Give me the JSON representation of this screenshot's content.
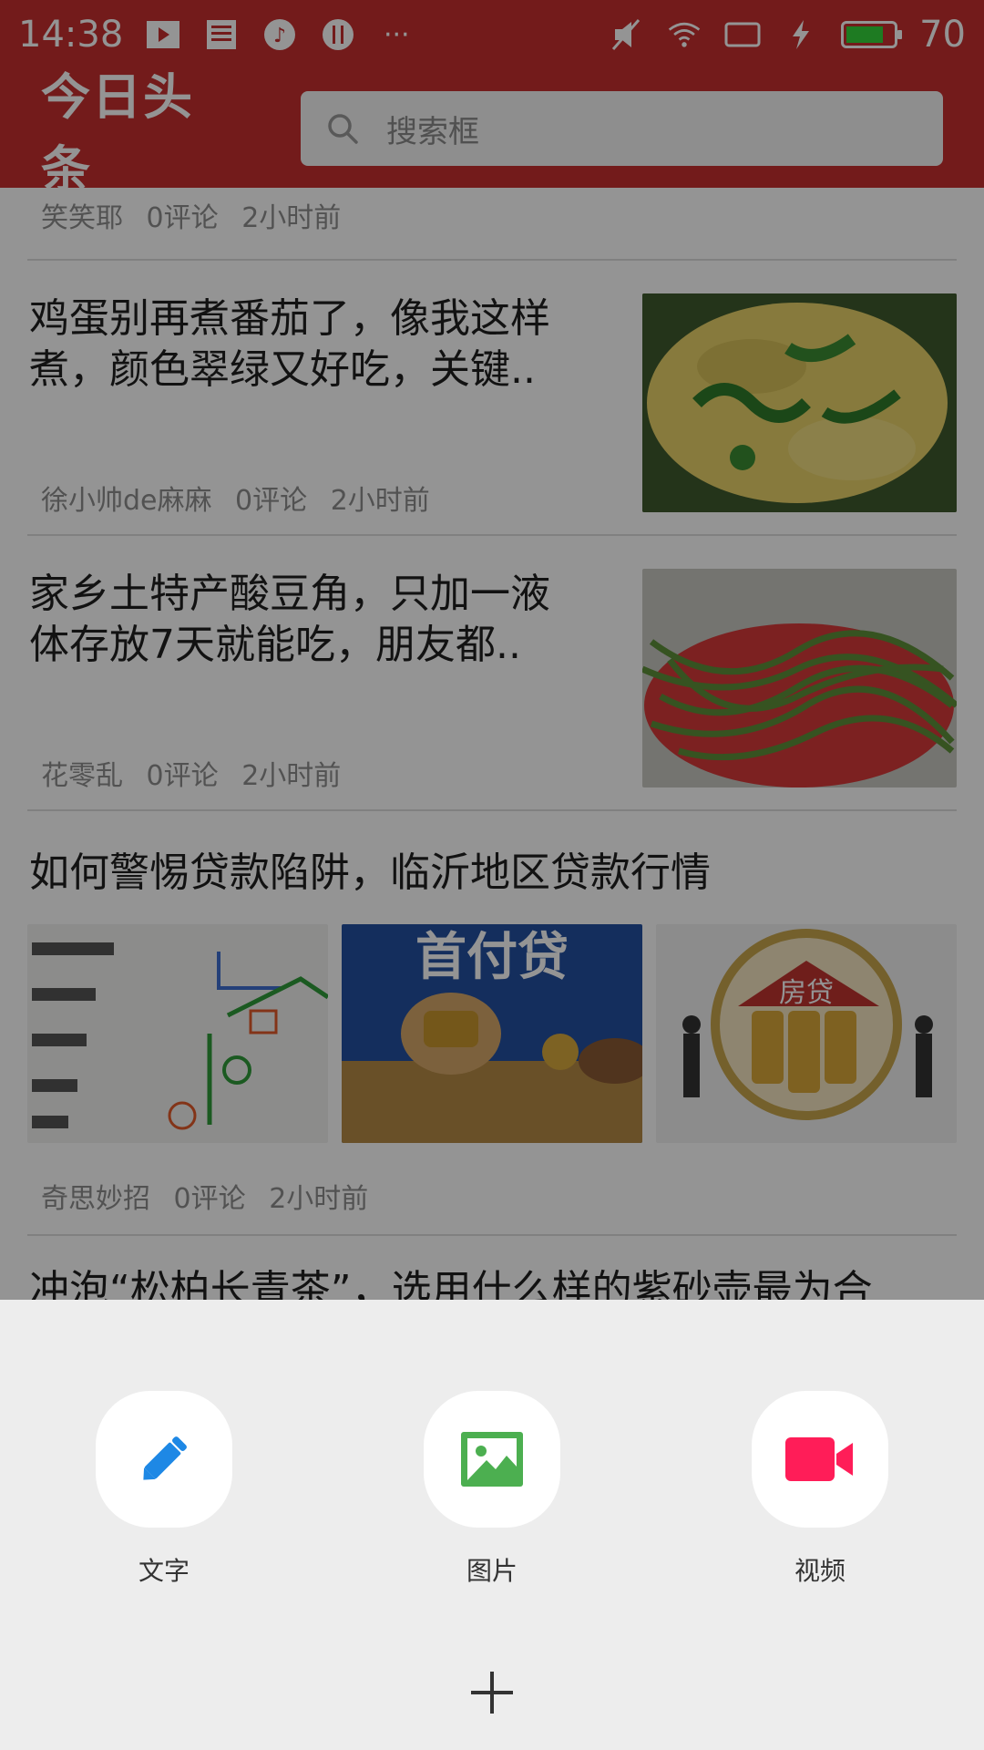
{
  "status_bar": {
    "time": "14:38",
    "battery": "70",
    "more": "···"
  },
  "header": {
    "logo": "今日头条",
    "search_placeholder": "搜索框"
  },
  "feed": {
    "partial_meta": {
      "author": "笑笑耶",
      "comments": "0评论",
      "time": "2小时前"
    },
    "articles": [
      {
        "title_line1": "鸡蛋别再煮番茄了，像我这样",
        "title_line2": "煮，颜色翠绿又好吃，关键..",
        "author": "徐小帅de麻麻",
        "comments": "0评论",
        "time": "2小时前"
      },
      {
        "title_line1": "家乡土特产酸豆角，只加一液",
        "title_line2": "体存放7天就能吃，朋友都..",
        "author": "花零乱",
        "comments": "0评论",
        "time": "2小时前"
      },
      {
        "title": "如何警惕贷款陷阱，临沂地区贷款行情",
        "author": "奇思妙招",
        "comments": "0评论",
        "time": "2小时前",
        "image_texts": [
          "首付贷",
          "房贷"
        ]
      },
      {
        "title": "冲泡“松柏长青茶”，选用什么样的紫砂壶最为合"
      }
    ]
  },
  "sheet": {
    "actions": [
      {
        "label": "文字",
        "icon": "pencil-icon",
        "color": "#1e88e5"
      },
      {
        "label": "图片",
        "icon": "image-icon",
        "color": "#4caf50"
      },
      {
        "label": "视频",
        "icon": "video-icon",
        "color": "#ff1d58"
      }
    ],
    "close_icon": "close-icon"
  }
}
